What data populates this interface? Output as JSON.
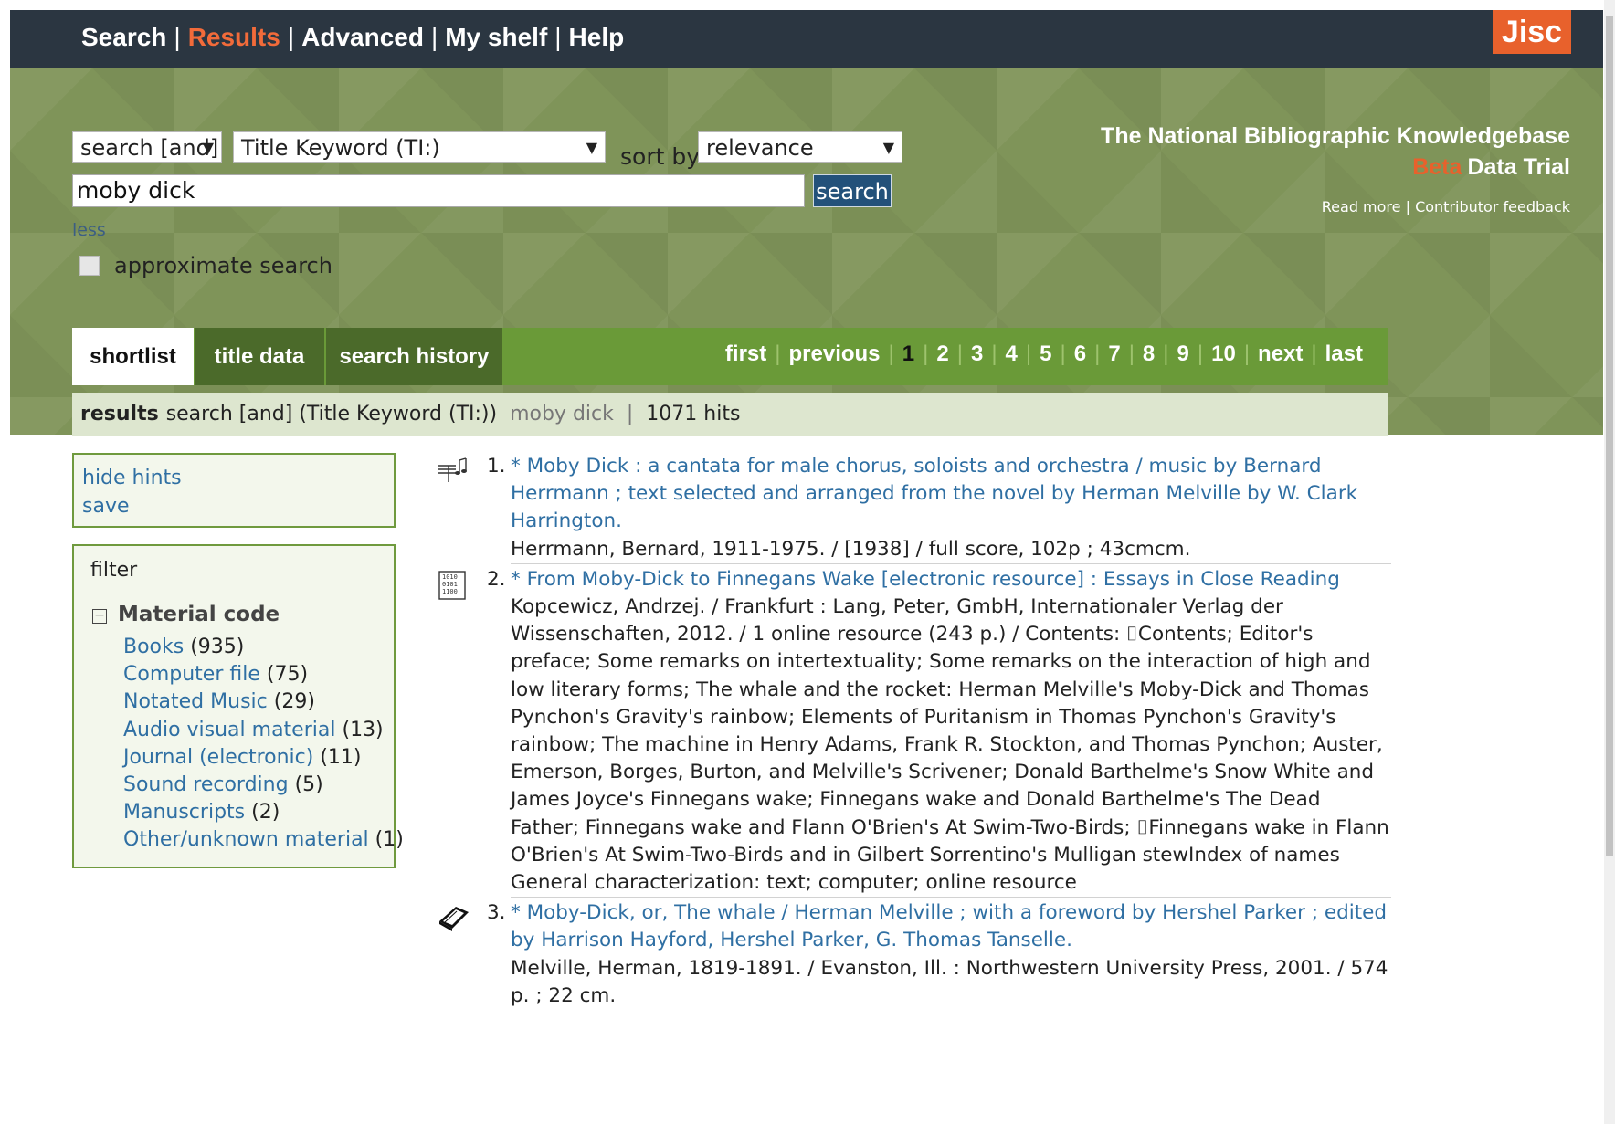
{
  "nav": {
    "items": [
      {
        "label": "Search"
      },
      {
        "label": "Results",
        "active": true
      },
      {
        "label": "Advanced"
      },
      {
        "label": "My shelf"
      },
      {
        "label": "Help"
      }
    ],
    "separator": "|",
    "logo": "Jisc"
  },
  "search": {
    "operator": "search [and]",
    "field": "Title Keyword (TI:)",
    "sort_label": "sort by",
    "sort_value": "relevance",
    "query": "moby dick",
    "button": "search",
    "less": "less",
    "approximate": "approximate search"
  },
  "brand": {
    "title": "The National Bibliographic Knowledgebase",
    "beta": "Beta",
    "subtitle": "Data Trial",
    "read_more": "Read more",
    "sep": "|",
    "feedback": "Contributor feedback"
  },
  "tabs": [
    {
      "label": "shortlist",
      "active": true
    },
    {
      "label": "title data"
    },
    {
      "label": "search history"
    }
  ],
  "pager": {
    "first": "first",
    "previous": "previous",
    "pages": [
      "1",
      "2",
      "3",
      "4",
      "5",
      "6",
      "7",
      "8",
      "9",
      "10"
    ],
    "current": "1",
    "next": "next",
    "last": "last"
  },
  "results_bar": {
    "label": "results",
    "query_desc": "search [and]  (Title Keyword (TI:))",
    "query": "moby dick",
    "sep": "|",
    "hits": "1071 hits"
  },
  "hints": {
    "hide": "hide hints",
    "save": "save"
  },
  "filter": {
    "title": "filter",
    "group": "Material code",
    "items": [
      {
        "label": "Books",
        "count": "(935)"
      },
      {
        "label": "Computer file",
        "count": "(75)"
      },
      {
        "label": "Notated Music",
        "count": "(29)"
      },
      {
        "label": "Audio visual material",
        "count": "(13)"
      },
      {
        "label": "Journal (electronic)",
        "count": "(11)"
      },
      {
        "label": "Sound recording",
        "count": "(5)"
      },
      {
        "label": "Manuscripts",
        "count": "(2)"
      },
      {
        "label": "Other/unknown material",
        "count": "(1)"
      }
    ]
  },
  "results": [
    {
      "num": "1.",
      "icon": "music-score-icon",
      "title": "* Moby Dick : a cantata for male chorus, soloists and orchestra / music by Bernard Herrmann ; text selected and arranged from the novel by Herman Melville by W. Clark Harrington.",
      "lines": [
        "Herrmann, Bernard, 1911-1975. / [1938] / full score, 102p ; 43cmcm."
      ]
    },
    {
      "num": "2.",
      "icon": "computer-file-icon",
      "title": "* From Moby-Dick to Finnegans Wake [electronic resource] : Essays in Close Reading",
      "lines": [
        "Kopcewicz, Andrzej. / Frankfurt : Lang, Peter, GmbH, Internationaler Verlag der Wissenschaften, 2012. / 1 online resource (243 p.) / Contents: ⌷Contents; Editor's preface; Some remarks on intertextuality; Some remarks on the interaction of high and low literary forms; The whale and the rocket: Herman Melville's Moby-Dick and Thomas Pynchon's Gravity's rainbow; Elements of Puritanism in Thomas Pynchon's Gravity's rainbow; The machine in Henry Adams, Frank R. Stockton, and Thomas Pynchon; Auster, Emerson, Borges, Burton, and Melville's Scrivener; Donald Barthelme's Snow White and James Joyce's Finnegans wake; Finnegans wake and Donald Barthelme's The Dead Father; Finnegans wake and Flann O'Brien's At Swim-Two-Birds; ⌷Finnegans wake in Flann O'Brien's At Swim-Two-Birds and in Gilbert Sorrentino's Mulligan stewIndex of names",
        "General characterization: text; computer; online resource"
      ]
    },
    {
      "num": "3.",
      "icon": "book-icon",
      "title": "* Moby-Dick, or, The whale / Herman Melville ; with a foreword by Hershel Parker ; edited by Harrison Hayford, Hershel Parker, G. Thomas Tanselle.",
      "lines": [
        "Melville, Herman, 1819-1891. / Evanston, Ill. : Northwestern University Press, 2001. / 574 p. ; 22 cm."
      ]
    }
  ]
}
